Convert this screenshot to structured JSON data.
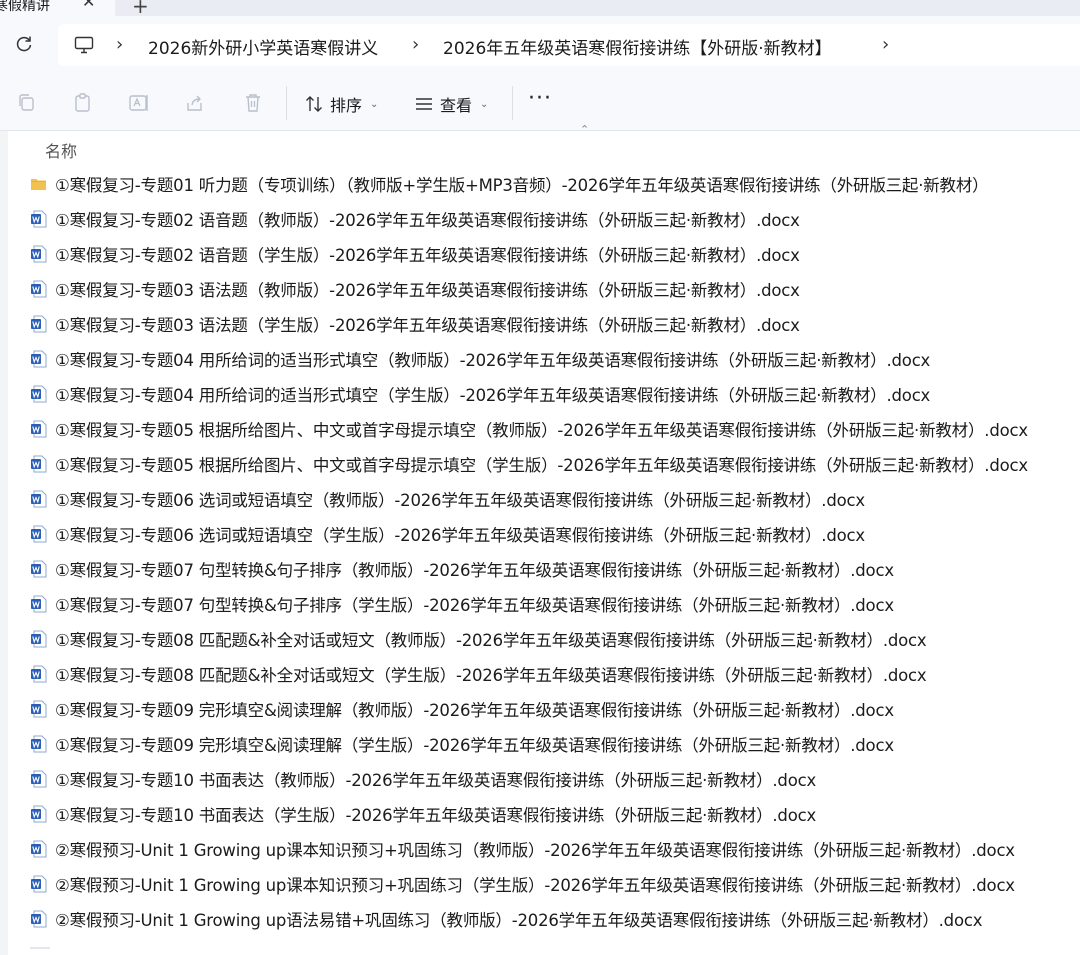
{
  "tab": {
    "title": "寒假精讲",
    "close_glyph": "✕",
    "new_glyph": "+"
  },
  "breadcrumb": {
    "separator": "›",
    "items": [
      "2026新外研小学英语寒假讲义",
      "2026年五年级英语寒假衔接讲练【外研版·新教材】"
    ]
  },
  "toolbar": {
    "sort_label": "排序",
    "view_label": "查看",
    "more_label": "···",
    "sort_caret": "⌃"
  },
  "list": {
    "column_name": "名称",
    "items": [
      {
        "type": "folder",
        "name": "①寒假复习-专题01 听力题（专项训练）（教师版+学生版+MP3音频）-2026学年五年级英语寒假衔接讲练（外研版三起·新教材）"
      },
      {
        "type": "docx",
        "name": "①寒假复习-专题02 语音题（教师版）-2026学年五年级英语寒假衔接讲练（外研版三起·新教材）.docx"
      },
      {
        "type": "docx",
        "name": "①寒假复习-专题02 语音题（学生版）-2026学年五年级英语寒假衔接讲练（外研版三起·新教材）.docx"
      },
      {
        "type": "docx",
        "name": "①寒假复习-专题03 语法题（教师版）-2026学年五年级英语寒假衔接讲练（外研版三起·新教材）.docx"
      },
      {
        "type": "docx",
        "name": "①寒假复习-专题03 语法题（学生版）-2026学年五年级英语寒假衔接讲练（外研版三起·新教材）.docx"
      },
      {
        "type": "docx",
        "name": "①寒假复习-专题04 用所给词的适当形式填空（教师版）-2026学年五年级英语寒假衔接讲练（外研版三起·新教材）.docx"
      },
      {
        "type": "docx",
        "name": "①寒假复习-专题04 用所给词的适当形式填空（学生版）-2026学年五年级英语寒假衔接讲练（外研版三起·新教材）.docx"
      },
      {
        "type": "docx",
        "name": "①寒假复习-专题05 根据所给图片、中文或首字母提示填空（教师版）-2026学年五年级英语寒假衔接讲练（外研版三起·新教材）.docx"
      },
      {
        "type": "docx",
        "name": "①寒假复习-专题05 根据所给图片、中文或首字母提示填空（学生版）-2026学年五年级英语寒假衔接讲练（外研版三起·新教材）.docx"
      },
      {
        "type": "docx",
        "name": "①寒假复习-专题06 选词或短语填空（教师版）-2026学年五年级英语寒假衔接讲练（外研版三起·新教材）.docx"
      },
      {
        "type": "docx",
        "name": "①寒假复习-专题06 选词或短语填空（学生版）-2026学年五年级英语寒假衔接讲练（外研版三起·新教材）.docx"
      },
      {
        "type": "docx",
        "name": "①寒假复习-专题07 句型转换&句子排序（教师版）-2026学年五年级英语寒假衔接讲练（外研版三起·新教材）.docx"
      },
      {
        "type": "docx",
        "name": "①寒假复习-专题07 句型转换&句子排序（学生版）-2026学年五年级英语寒假衔接讲练（外研版三起·新教材）.docx"
      },
      {
        "type": "docx",
        "name": "①寒假复习-专题08 匹配题&补全对话或短文（教师版）-2026学年五年级英语寒假衔接讲练（外研版三起·新教材）.docx"
      },
      {
        "type": "docx",
        "name": "①寒假复习-专题08 匹配题&补全对话或短文（学生版）-2026学年五年级英语寒假衔接讲练（外研版三起·新教材）.docx"
      },
      {
        "type": "docx",
        "name": "①寒假复习-专题09 完形填空&阅读理解（教师版）-2026学年五年级英语寒假衔接讲练（外研版三起·新教材）.docx"
      },
      {
        "type": "docx",
        "name": "①寒假复习-专题09 完形填空&阅读理解（学生版）-2026学年五年级英语寒假衔接讲练（外研版三起·新教材）.docx"
      },
      {
        "type": "docx",
        "name": "①寒假复习-专题10 书面表达（教师版）-2026学年五年级英语寒假衔接讲练（外研版三起·新教材）.docx"
      },
      {
        "type": "docx",
        "name": "①寒假复习-专题10 书面表达（学生版）-2026学年五年级英语寒假衔接讲练（外研版三起·新教材）.docx"
      },
      {
        "type": "docx",
        "name": "②寒假预习-Unit 1 Growing up课本知识预习+巩固练习（教师版）-2026学年五年级英语寒假衔接讲练（外研版三起·新教材）.docx"
      },
      {
        "type": "docx",
        "name": "②寒假预习-Unit 1 Growing up课本知识预习+巩固练习（学生版）-2026学年五年级英语寒假衔接讲练（外研版三起·新教材）.docx"
      },
      {
        "type": "docx",
        "name": "②寒假预习-Unit 1 Growing up语法易错+巩固练习（教师版）-2026学年五年级英语寒假衔接讲练（外研版三起·新教材）.docx"
      }
    ]
  },
  "colors": {
    "folder": "#f2c14e",
    "word": "#2b5fb5",
    "chrome": "#f7f9fc"
  }
}
